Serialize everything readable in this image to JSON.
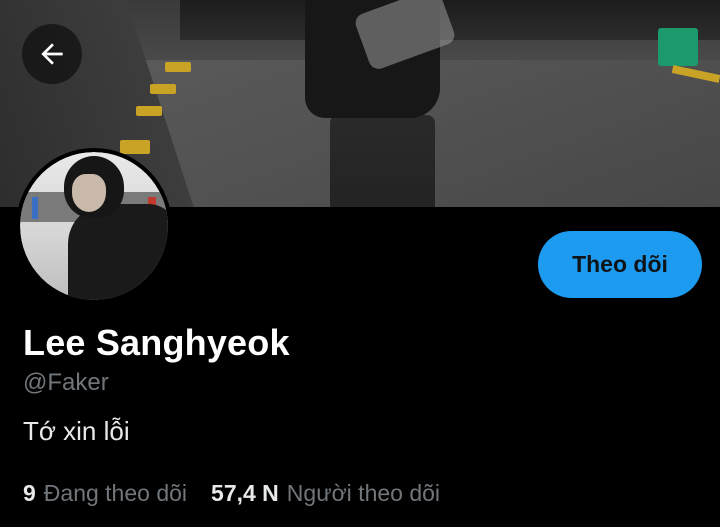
{
  "header": {
    "back_icon": "arrow-left-icon"
  },
  "profile": {
    "display_name": "Lee Sanghyeok",
    "handle": "@Faker",
    "bio": "Tớ xin lỗi",
    "follow_label": "Theo dõi"
  },
  "stats": {
    "following_count": "9",
    "following_label": "Đang theo dõi",
    "followers_count": "57,4 N",
    "followers_label": "Người theo dõi"
  },
  "colors": {
    "accent": "#1d9bf0",
    "background": "#000000",
    "secondary_text": "#71767b",
    "primary_text": "#e7e9ea"
  }
}
